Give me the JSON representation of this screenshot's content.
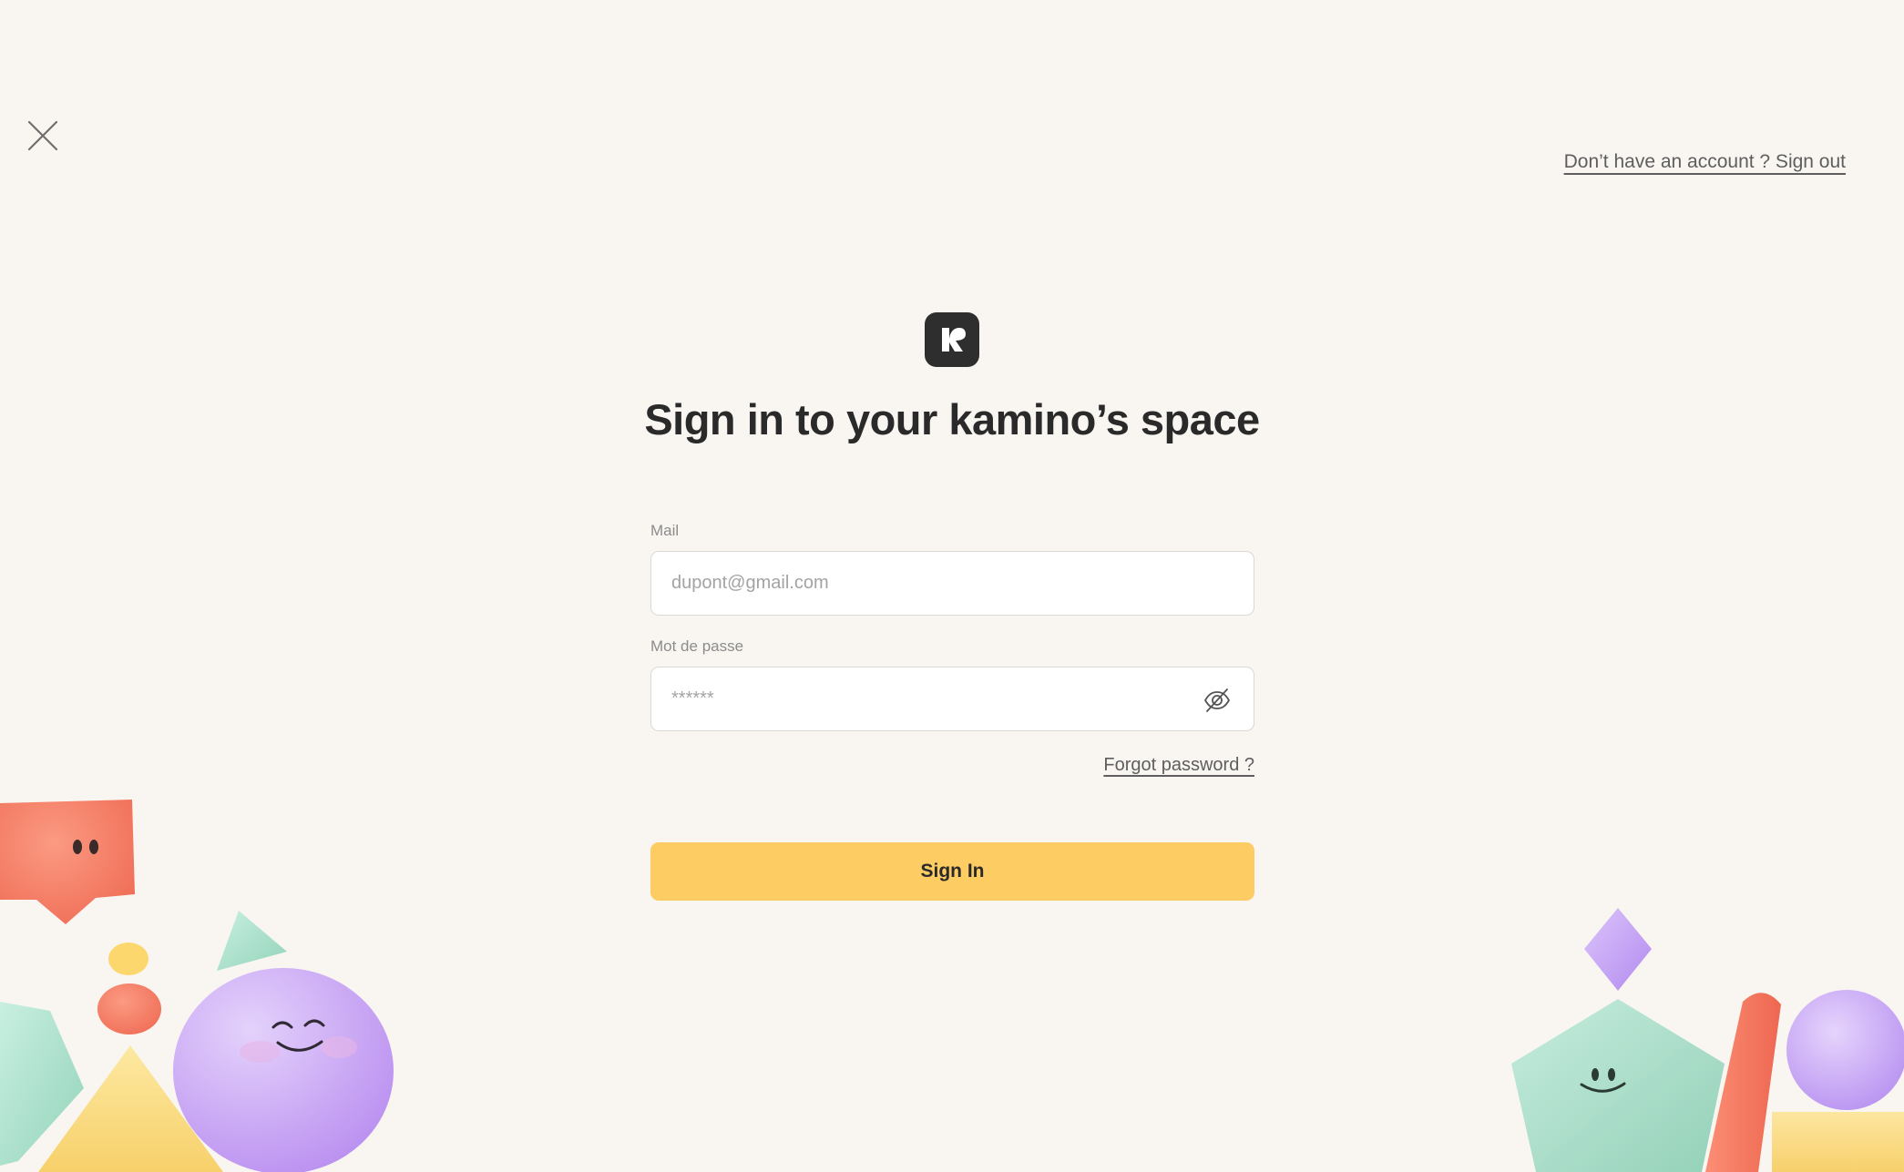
{
  "header": {
    "close_icon": "close-icon",
    "signup_link": "Don’t have an account ? Sign out"
  },
  "brand": {
    "logo_icon": "kamino-k-logo",
    "title": "Sign in to your kamino’s space"
  },
  "form": {
    "mail_label": "Mail",
    "mail_placeholder": "dupont@gmail.com",
    "password_label": "Mot de passe",
    "password_placeholder": "******",
    "password_toggle_icon": "eye-off-icon",
    "forgot_link": "Forgot password ?",
    "submit_label": "Sign In"
  },
  "colors": {
    "background": "#f9f6f1",
    "primary_button": "#fdcc63",
    "logo_bg": "#2e2e2e",
    "coral": "#f47c65",
    "lavender": "#c9a6f5",
    "mint": "#a9dcc8",
    "butter": "#fbe089"
  }
}
